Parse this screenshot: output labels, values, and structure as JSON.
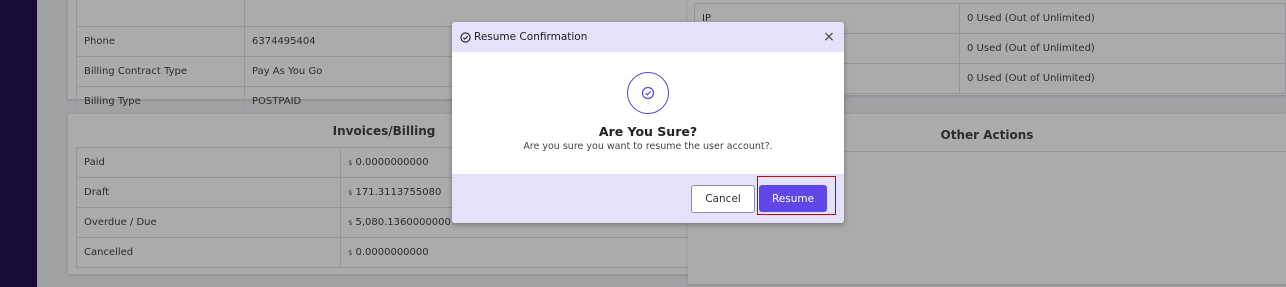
{
  "account_details": {
    "rows": [
      {
        "label": "Phone",
        "value": "6374495404"
      },
      {
        "label": "Billing Contract Type",
        "value": "Pay As You Go"
      },
      {
        "label": "Billing Type",
        "value": "POSTPAID"
      }
    ]
  },
  "usage": {
    "rows": [
      {
        "label": "IP",
        "value": "0 Used (Out of Unlimited)"
      },
      {
        "label": "",
        "value": "0 Used (Out of Unlimited)"
      },
      {
        "label": "",
        "value": "0 Used (Out of Unlimited)"
      }
    ]
  },
  "invoices": {
    "title": "Invoices/Billing",
    "currency_symbol": "$",
    "rows": [
      {
        "label": "Paid",
        "value": "0.0000000000"
      },
      {
        "label": "Draft",
        "value": "171.3113755080"
      },
      {
        "label": "Overdue / Due",
        "value": "5,080.1360000000"
      },
      {
        "label": "Cancelled",
        "value": "0.0000000000"
      }
    ]
  },
  "other_actions": {
    "title": "Other Actions"
  },
  "modal": {
    "title": "Resume Confirmation",
    "close": "×",
    "heading": "Are You Sure?",
    "message": "Are you sure you want to resume the user account?.",
    "cancel_label": "Cancel",
    "resume_label": "Resume"
  },
  "colors": {
    "primary": "#6046e6",
    "sidebar": "#24114f",
    "modal_tint": "#e4e1f9",
    "highlight_outline": "#cc0000"
  }
}
